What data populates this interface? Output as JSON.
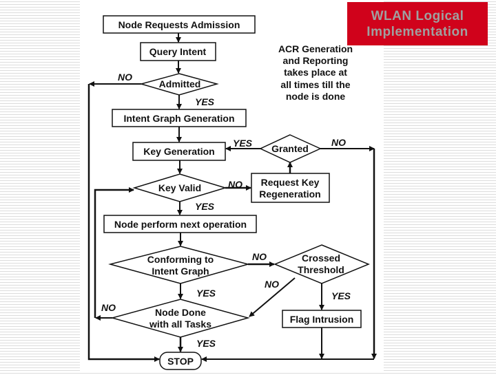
{
  "slide": {
    "title_line1": "WLAN Logical",
    "title_line2": "Implementation",
    "title_bg": "#d0021b",
    "title_fg": "#a0a0a0"
  },
  "flowchart": {
    "nodes": {
      "start": "Node Requests Admission",
      "query": "Query Intent",
      "admitted": "Admitted",
      "intent_graph": "Intent Graph Generation",
      "key_gen": "Key Generation",
      "granted": "Granted",
      "key_valid": "Key Valid",
      "request_key_1": "Request Key",
      "request_key_2": "Regeneration",
      "next_op": "Node perform next operation",
      "conforming_1": "Conforming to",
      "conforming_2": "Intent Graph",
      "crossed_1": "Crossed",
      "crossed_2": "Threshold",
      "done_1": "Node Done",
      "done_2": "with all Tasks",
      "flag": "Flag Intrusion",
      "stop": "STOP"
    },
    "note": [
      "ACR Generation",
      "and Reporting",
      "takes place at",
      "all times till the",
      "node is done"
    ],
    "labels": {
      "yes": "YES",
      "no": "NO"
    }
  }
}
